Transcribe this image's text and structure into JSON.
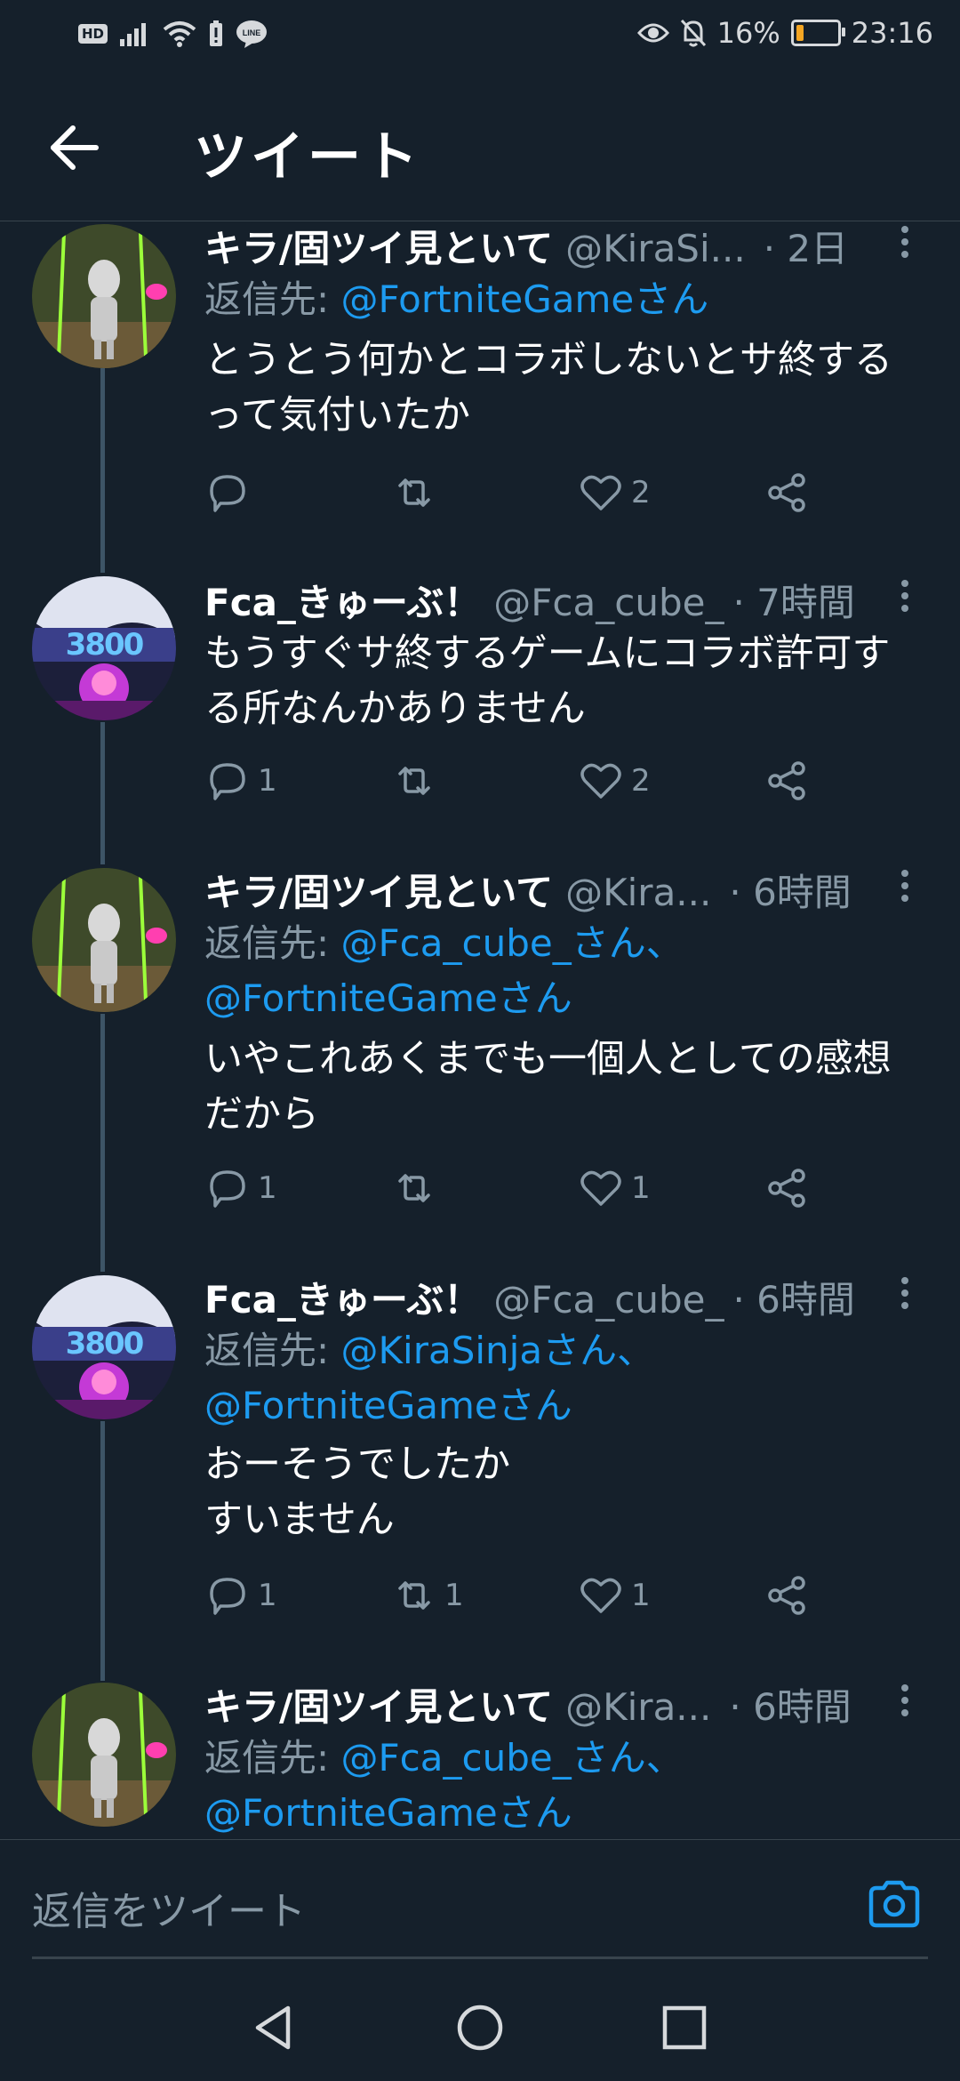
{
  "status_bar": {
    "hd": "HD",
    "line_badge": "LINE",
    "battery_percent": "16%",
    "battery_level": 0.16,
    "time": "23:16"
  },
  "header": {
    "title": "ツイート"
  },
  "tweets": [
    {
      "name": "キラ/固ツイ見といて",
      "handle": "@KiraSi...",
      "time": "· 2日",
      "reply_label": "返信先: ",
      "reply_mentions": "@FortniteGameさん",
      "reply_mentions_2": "",
      "text": "とうとう何かとコラボしないとサ終する\nって気付いたか",
      "replies": "",
      "retweets": "",
      "likes": "2"
    },
    {
      "name": "Fca_きゅーぶ！",
      "handle": "@Fca_cube_",
      "time": "· 7時間",
      "text": "もうすぐサ終するゲームにコラボ許可す\nる所なんかありません",
      "replies": "1",
      "retweets": "",
      "likes": "2"
    },
    {
      "name": "キラ/固ツイ見といて",
      "handle": "@Kira...",
      "time": "· 6時間",
      "reply_label": "返信先: ",
      "reply_mentions": "@Fca_cube_さん、",
      "reply_mentions_2": "@FortniteGameさん",
      "text": "いやこれあくまでも一個人としての感想\nだから",
      "replies": "1",
      "retweets": "",
      "likes": "1"
    },
    {
      "name": "Fca_きゅーぶ！",
      "handle": "@Fca_cube_",
      "time": "· 6時間",
      "reply_label": "返信先: ",
      "reply_mentions": "@KiraSinjaさん、",
      "reply_mentions_2": "@FortniteGameさん",
      "text": "おーそうでしたか\nすいません",
      "replies": "1",
      "retweets": "1",
      "likes": "1"
    },
    {
      "name": "キラ/固ツイ見といて",
      "handle": "@Kira...",
      "time": "· 6時間",
      "reply_label": "返信先: ",
      "reply_mentions": "@Fca_cube_さん、",
      "reply_mentions_2": "@FortniteGameさん"
    }
  ],
  "reply_bar": {
    "placeholder": "返信をツイート"
  },
  "colors": {
    "background": "#15202b",
    "accent": "#1d9bf0",
    "secondary_text": "#8899a6",
    "divider": "#38444d"
  }
}
